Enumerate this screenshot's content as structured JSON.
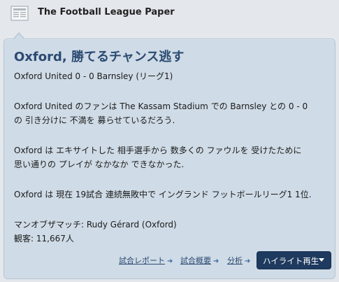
{
  "header": {
    "title": "The Football League Paper",
    "icon": "newspaper-icon"
  },
  "article": {
    "headline": "Oxford, 勝てるチャンス逃す",
    "score_line": "Oxford United 0 - 0 Barnsley (リーグ1)",
    "para1_line1": "Oxford United のファンは The Kassam Stadium での Barnsley との 0 - 0",
    "para1_line2": "の 引き分けに 不満を 募らせているだろう.",
    "para2_line1": "Oxford は エキサイトした 相手選手から 数多くの ファウルを 受けたために",
    "para2_line2": "思い通りの プレイが なかなか できなかった.",
    "para3": "Oxford は 現在 19試合 連続無敗中で イングランド フットボールリーグ1 1位.",
    "man_of_match": "マンオブザマッチ: Rudy Gérard (Oxford)",
    "attendance": "観客: 11,667人"
  },
  "actions": {
    "match_report": "試合レポート",
    "match_summary": "試合概要",
    "analysis": "分析",
    "highlights": "ハイライト再生"
  },
  "colors": {
    "card_bg": "#cfdbe6",
    "headline": "#2b4a72",
    "button_bg": "#1f3a5f"
  }
}
